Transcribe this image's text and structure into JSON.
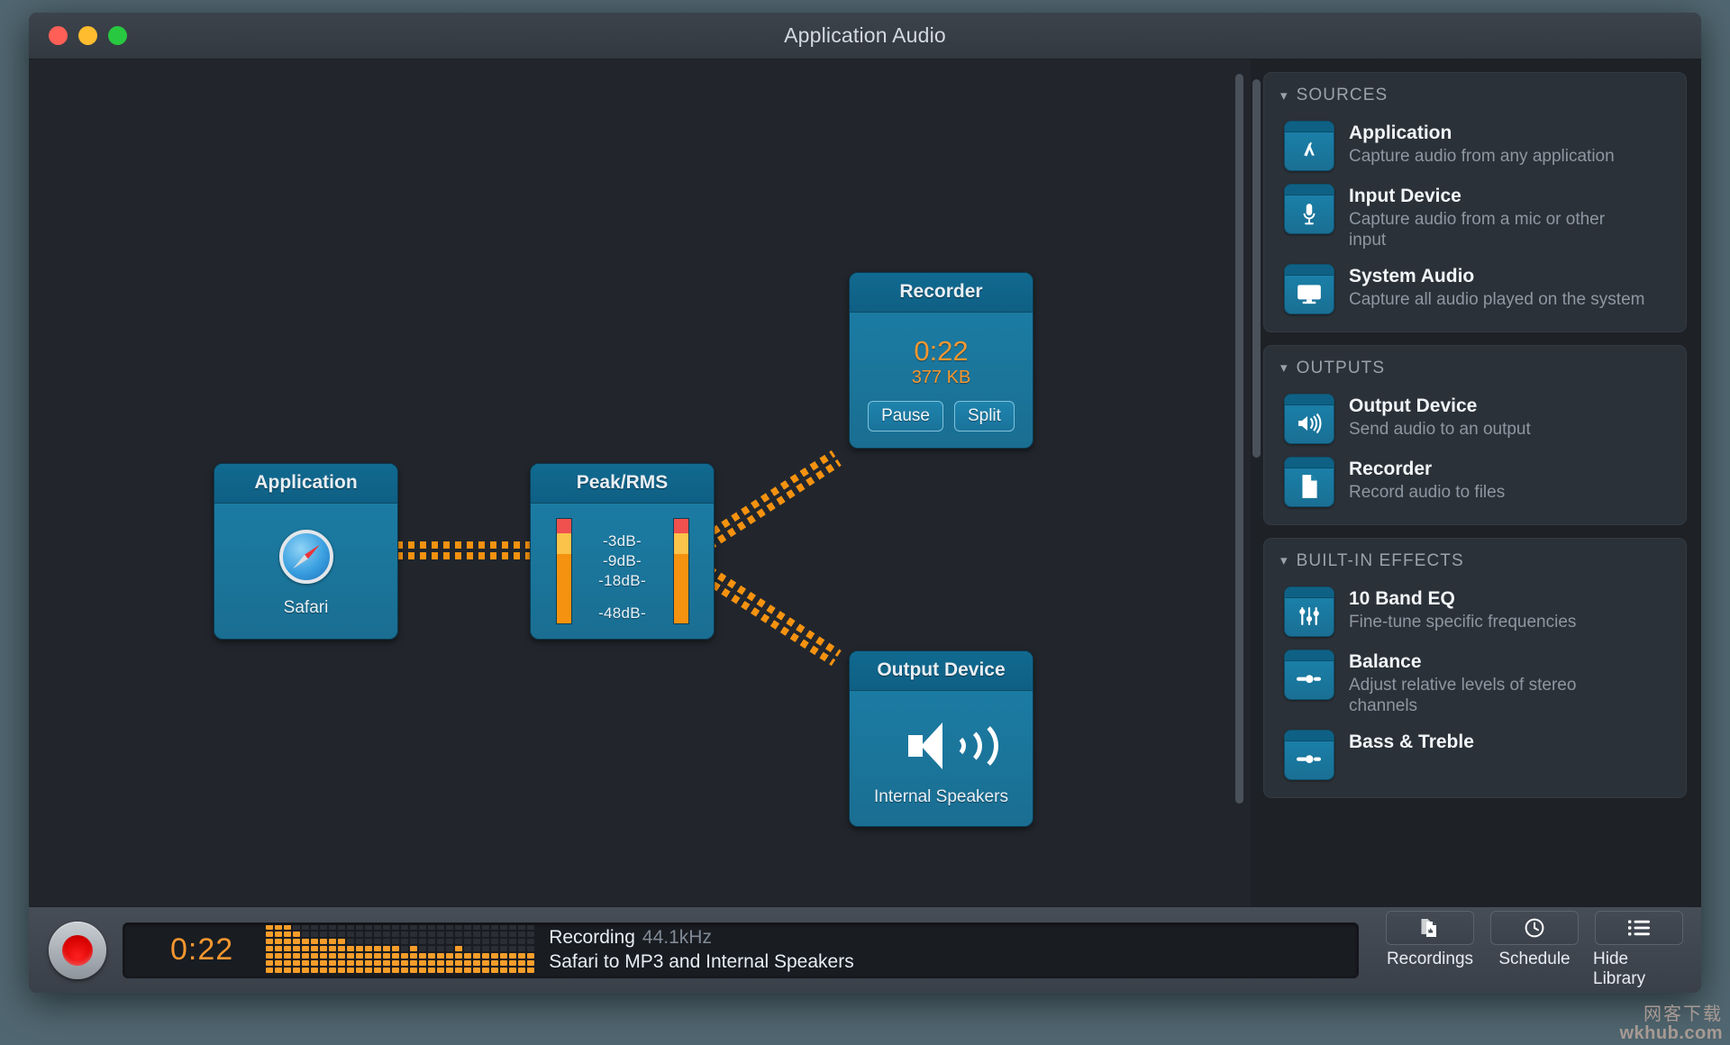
{
  "window": {
    "title": "Application Audio",
    "traffic_lights": [
      "close",
      "minimize",
      "zoom"
    ]
  },
  "canvas": {
    "nodes": [
      {
        "id": "application",
        "title": "Application",
        "icon": "safari-icon",
        "subtitle": "Safari"
      },
      {
        "id": "peak-rms",
        "title": "Peak/RMS",
        "labels": [
          "-3dB-",
          "-9dB-",
          "-18dB-",
          "-48dB-"
        ],
        "meter_left": {
          "red_pct": 14,
          "yellow_pct": 20,
          "orange_pct": 66
        },
        "meter_right": {
          "red_pct": 14,
          "yellow_pct": 20,
          "orange_pct": 66
        }
      },
      {
        "id": "recorder",
        "title": "Recorder",
        "time": "0:22",
        "size": "377 KB",
        "buttons": [
          "Pause",
          "Split"
        ]
      },
      {
        "id": "output-device",
        "title": "Output Device",
        "icon": "speaker-icon",
        "subtitle": "Internal Speakers"
      }
    ],
    "connections": [
      {
        "from": "application",
        "to": "peak-rms"
      },
      {
        "from": "peak-rms",
        "to": "recorder"
      },
      {
        "from": "peak-rms",
        "to": "output-device"
      }
    ]
  },
  "sidebar": {
    "sections": [
      {
        "title": "SOURCES",
        "collapsed": false,
        "items": [
          {
            "icon": "app-store-icon",
            "title": "Application",
            "desc": "Capture audio from any application"
          },
          {
            "icon": "microphone-icon",
            "title": "Input Device",
            "desc": "Capture audio from a mic or other input"
          },
          {
            "icon": "monitor-icon",
            "title": "System Audio",
            "desc": "Capture all audio played on the system"
          }
        ]
      },
      {
        "title": "OUTPUTS",
        "collapsed": false,
        "items": [
          {
            "icon": "speaker-icon",
            "title": "Output Device",
            "desc": "Send audio to an output"
          },
          {
            "icon": "document-icon",
            "title": "Recorder",
            "desc": "Record audio to files"
          }
        ]
      },
      {
        "title": "BUILT-IN EFFECTS",
        "collapsed": false,
        "items": [
          {
            "icon": "sliders-icon",
            "title": "10 Band EQ",
            "desc": "Fine-tune specific frequencies"
          },
          {
            "icon": "balance-slider-icon",
            "title": "Balance",
            "desc": "Adjust relative levels of stereo channels"
          },
          {
            "icon": "balance-slider-icon",
            "title": "Bass & Treble",
            "desc": ""
          }
        ]
      }
    ]
  },
  "toolbar": {
    "record_button": "record-button",
    "time": "0:22",
    "status_line1": "Recording",
    "status_rate": "44.1kHz",
    "status_line2": "Safari to MP3 and Internal Speakers",
    "buttons": [
      {
        "icon": "recordings-icon",
        "label": "Recordings"
      },
      {
        "icon": "clock-icon",
        "label": "Schedule"
      },
      {
        "icon": "list-icon",
        "label": "Hide Library"
      }
    ]
  },
  "watermark": {
    "cn": "网客下载",
    "en": "wkhub.com"
  },
  "colors": {
    "accent_orange": "#f79730",
    "node_blue": "#1c7fa8",
    "window_bg": "#262a30",
    "canvas_bg": "#22262c",
    "sidebar_bg": "#1e2126",
    "desktop_bg": "#506670"
  }
}
